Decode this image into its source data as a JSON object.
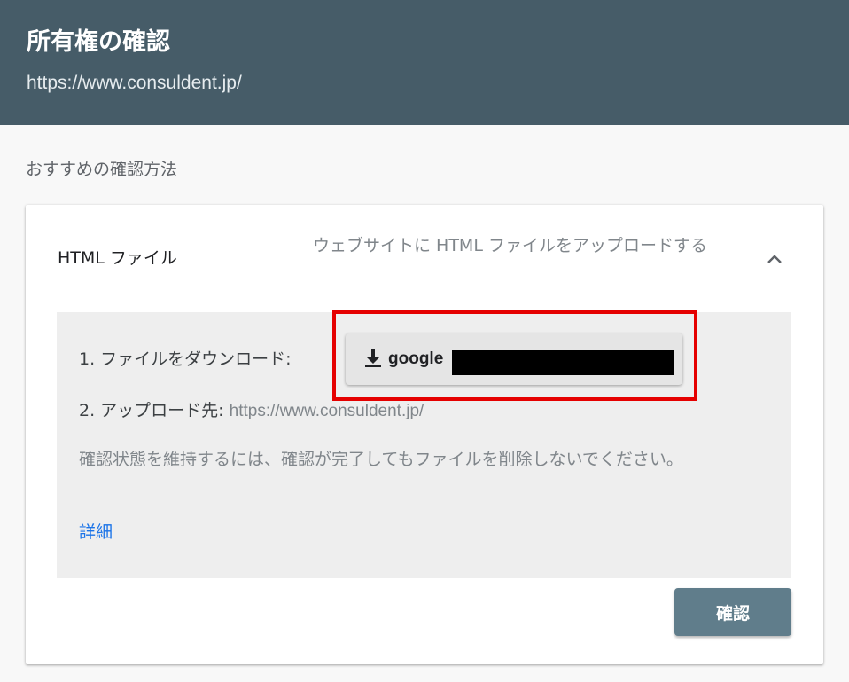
{
  "header": {
    "title": "所有権の確認",
    "url": "https://www.consuldent.jp/"
  },
  "section": {
    "label": "おすすめの確認方法"
  },
  "method": {
    "name": "HTML ファイル",
    "description": "ウェブサイトに HTML ファイルをアップロードする",
    "collapse_icon": "chevron-up-icon"
  },
  "steps": {
    "step1_label": "1. ファイルをダウンロード:",
    "download_icon": "download-icon",
    "download_filename": "google",
    "step2_label": "2. アップロード先:",
    "step2_url": "https://www.consuldent.jp/"
  },
  "note": "確認状態を維持するには、確認が完了してもファイルを削除しないでください。",
  "details_link": "詳細",
  "verify_button": "確認",
  "colors": {
    "header_bg": "#465c68",
    "primary_button": "#607d8b",
    "link": "#1a73e8",
    "highlight": "#e50000"
  }
}
